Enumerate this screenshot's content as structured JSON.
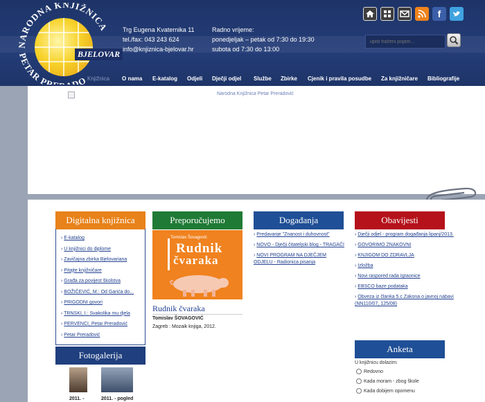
{
  "header": {
    "logo": {
      "arc_top": "NARODNA KNJIŽNICA",
      "arc_bottom": "PETAR PRERADOVIĆ",
      "city": "BJELOVAR"
    },
    "contact": {
      "address": "Trg Eugena Kvaternika 11",
      "phone": "tel./fax: 043 243 624",
      "email": "info@knjiznica-bjelovar.hr"
    },
    "hours": {
      "title": "Radno vrijeme:",
      "weekdays": "ponedjeljak – petak od 7:30 do 19:30",
      "saturday": "subota od 7:30 do 13:00"
    },
    "social_icons": [
      "home-icon",
      "sitemap-icon",
      "mail-icon",
      "rss-icon",
      "facebook-icon",
      "twitter-icon"
    ],
    "search": {
      "placeholder": "upiši traženi pojam..."
    },
    "nav": [
      "Knjižnica",
      "O nama",
      "E-katalog",
      "Odjeli",
      "Dječji odjel",
      "Službe",
      "Zbirke",
      "Cjenik i pravila posudbe",
      "Za knjižničare",
      "Bibliografije"
    ]
  },
  "banner": {
    "alt_text": "Narodna Knjižnica Petar Preradović"
  },
  "digital": {
    "title": "Digitalna knjižnica",
    "items": [
      "E-katalog",
      "U knjižnici do diplome",
      "Zavičajna zbirka Bjelovariana",
      "Pitajte knjižničare",
      "Građa za povijest školstva",
      "BOŽIČEVIĆ, M.: Od Garića do...",
      "PRIGODNI govori",
      "TRNSKI, I.: Svakolika mu djela",
      "PERVENCI, Petar Preradović",
      "Petar Preradović"
    ]
  },
  "gallery": {
    "title": "Fotogalerija",
    "captions": [
      "2011. -",
      "2011. - pogled"
    ]
  },
  "recommend": {
    "title": "Preporučujemo",
    "cover_author": "Tomislav Šovagović",
    "cover_title_1": "Rudnik",
    "cover_title_2": "čvaraka",
    "book_title": "Rudnik čvaraka",
    "book_author": "Tomislav ŠOVAGOVIĆ",
    "book_pub": "Zagreb : Mozaik knjiga, 2012."
  },
  "events": {
    "title": "Događanja",
    "items": [
      "Predavanje \"Znanost i duhovnost\"",
      "NOVO - Dječji čitateljski blog - TRAGAČI",
      "NOVI PROGRAM NA DJEČJEM ODJELU - Radionica pisanja"
    ]
  },
  "notices": {
    "title": "Obavijesti",
    "items": [
      "Dječji odjel - program događanja lipanj/2013.",
      "GOVORIMO ZNAKOVNI",
      "KNJIGOM DO ZDRAVLJA",
      "Izložba",
      "Novi raspored rada Igraonice",
      "EBSCO baze podataka",
      "Obveza iz članka 5.c Zakona o javnoj nabavi (NN110/07, 125/08)"
    ]
  },
  "poll": {
    "title": "Anketa",
    "question": "U knjižnicu dolazim:",
    "options": [
      "Redovno",
      "Kada moram - zbog škole",
      "Kada dobijem opomenu"
    ]
  },
  "colors": {
    "header_bg": "#1e3468",
    "digital_orange": "#e8821a",
    "recommend_green": "#1f7a35",
    "events_blue": "#1f4f96",
    "notices_red": "#b5121b",
    "gallery_navy": "#1f3f7e",
    "link_blue": "#21408f"
  }
}
